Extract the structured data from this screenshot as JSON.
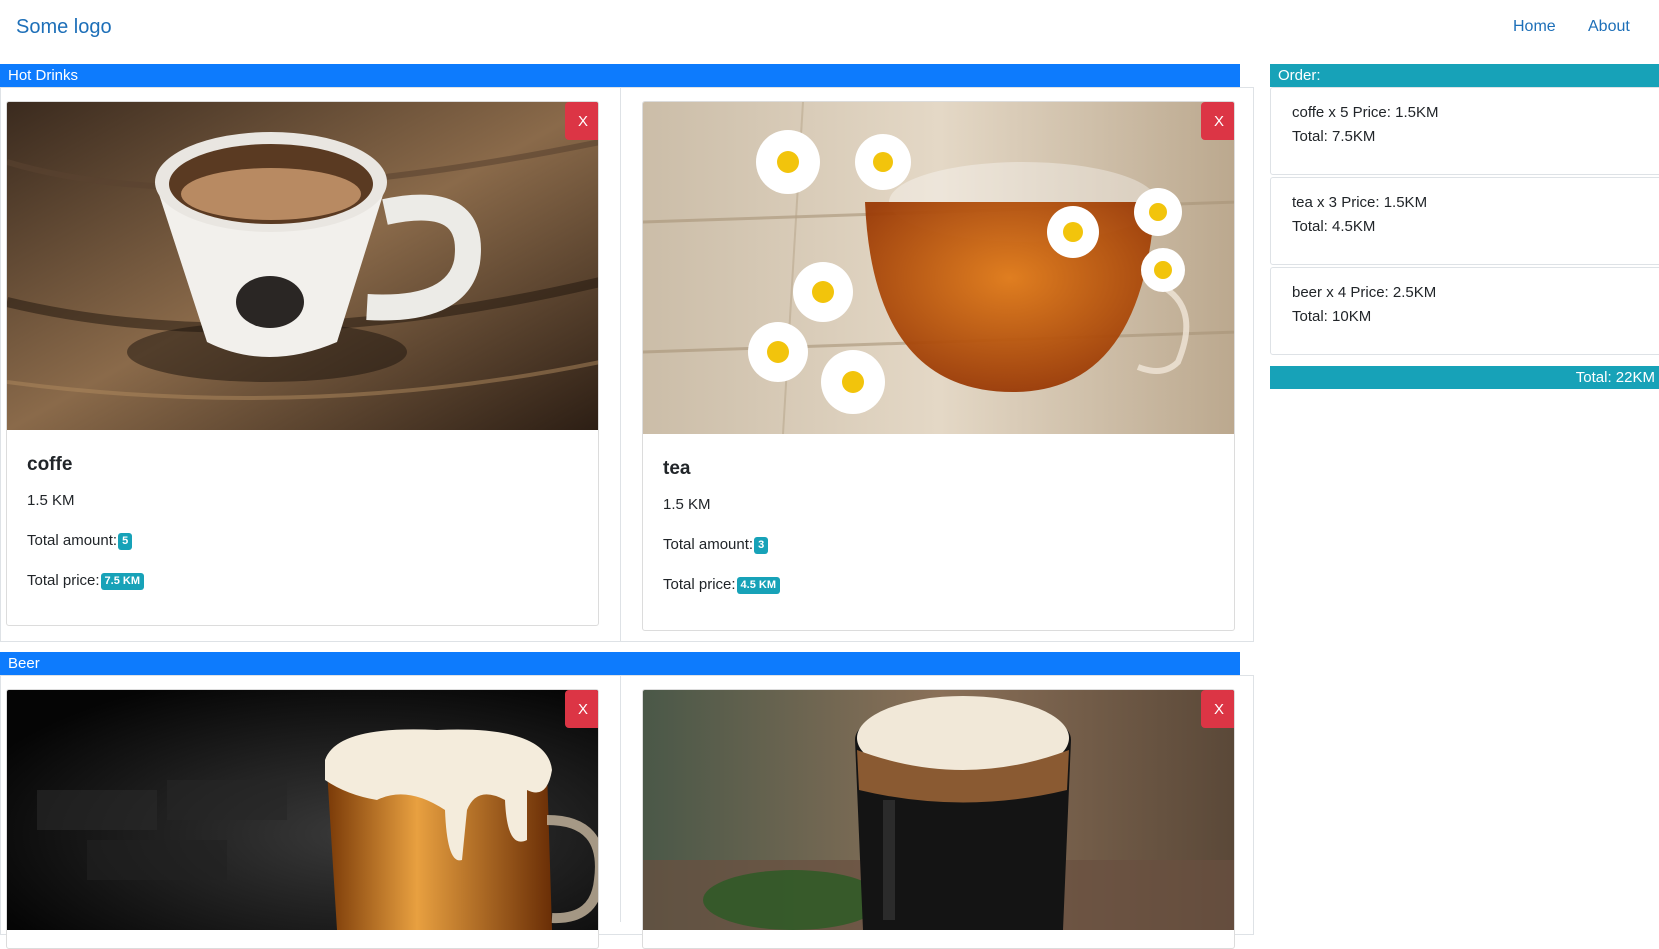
{
  "header": {
    "logo": "Some logo",
    "nav": [
      {
        "label": "Home"
      },
      {
        "label": "About"
      }
    ]
  },
  "sections": [
    {
      "title": "Hot Drinks",
      "items": [
        {
          "name": "coffe",
          "price": "1.5 KM",
          "amount_label": "Total amount:",
          "amount": "5",
          "total_label": "Total price:",
          "total": "7.5 KM",
          "remove_label": "X",
          "image": "coffee-cup-photo"
        },
        {
          "name": "tea",
          "price": "1.5 KM",
          "amount_label": "Total amount:",
          "amount": "3",
          "total_label": "Total price:",
          "total": "4.5 KM",
          "remove_label": "X",
          "image": "tea-cup-photo"
        }
      ]
    },
    {
      "title": "Beer",
      "items": [
        {
          "remove_label": "X",
          "image": "beer-mug-photo"
        },
        {
          "remove_label": "X",
          "image": "stout-glass-photo"
        }
      ]
    }
  ],
  "order": {
    "title": "Order:",
    "items": [
      {
        "line1": "coffe x 5 Price: 1.5KM",
        "line2": "Total: 7.5KM"
      },
      {
        "line1": "tea x 3 Price: 1.5KM",
        "line2": "Total: 4.5KM"
      },
      {
        "line1": "beer x 4 Price: 2.5KM",
        "line2": "Total: 10KM"
      }
    ],
    "total": "Total: 22KM"
  },
  "colors": {
    "primary": "#0d7bfd",
    "info": "#17a2b8",
    "danger": "#dc3545",
    "link": "#1d6fb8"
  }
}
